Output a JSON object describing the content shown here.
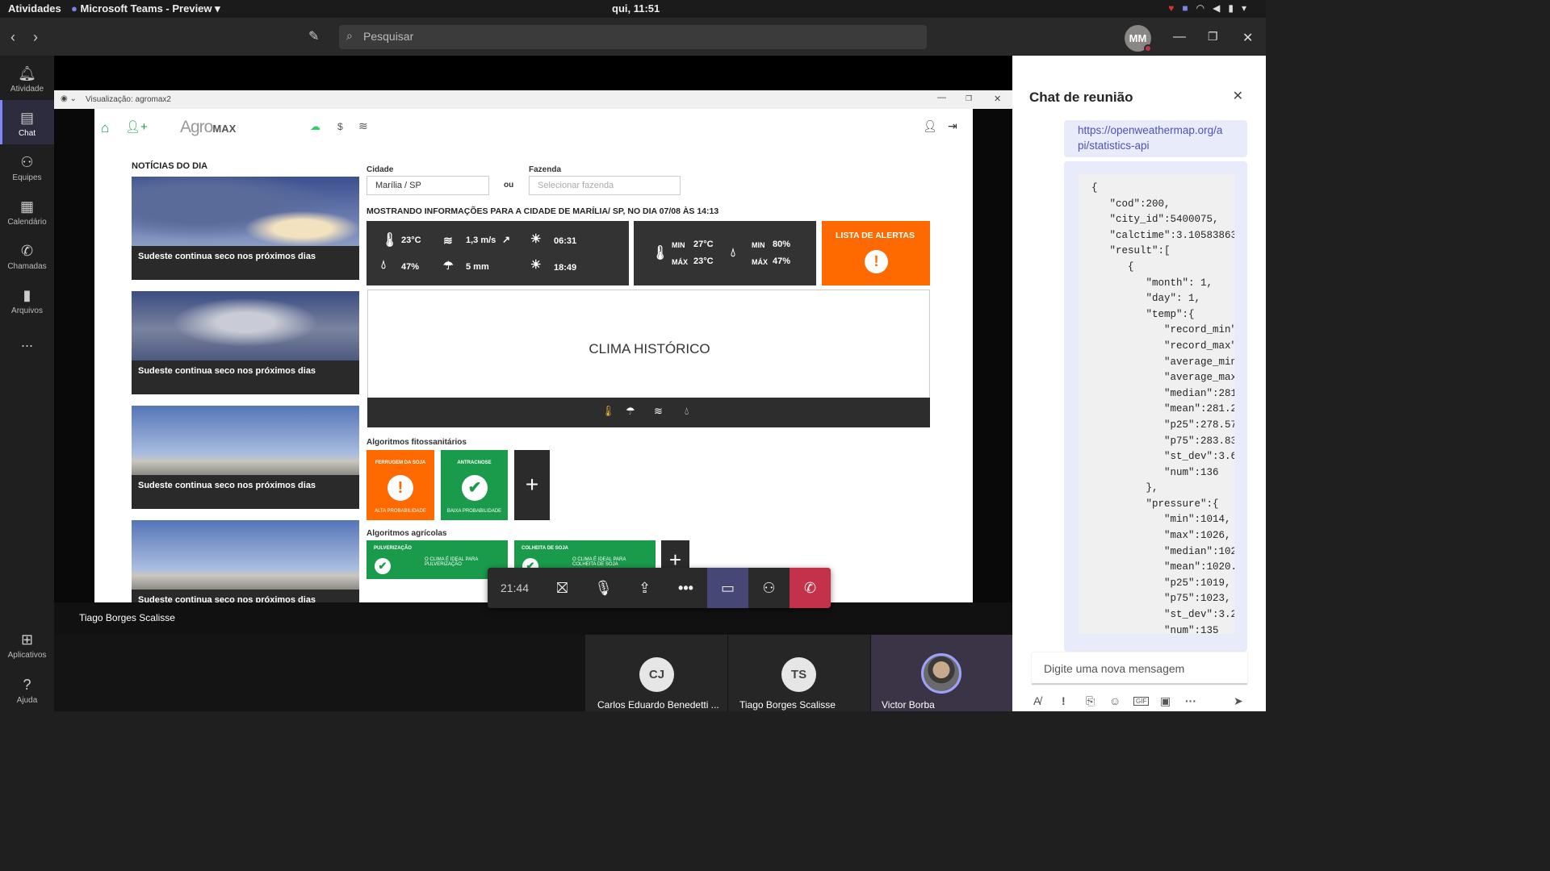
{
  "system_bar": {
    "activities": "Atividades",
    "app_name": "Microsoft Teams - Preview",
    "clock": "qui, 11:51"
  },
  "teams": {
    "search_placeholder": "Pesquisar",
    "avatar_initials": "MM",
    "rail": [
      {
        "label": "Atividade",
        "icon": "bell-icon"
      },
      {
        "label": "Chat",
        "icon": "chat-icon",
        "active": true
      },
      {
        "label": "Equipes",
        "icon": "teams-icon"
      },
      {
        "label": "Calendário",
        "icon": "calendar-icon"
      },
      {
        "label": "Chamadas",
        "icon": "phone-icon"
      },
      {
        "label": "Arquivos",
        "icon": "file-icon"
      },
      {
        "label": "...",
        "icon": "more-icon"
      }
    ],
    "rail_bottom": [
      {
        "label": "Aplicativos",
        "icon": "apps-icon"
      },
      {
        "label": "Ajuda",
        "icon": "help-icon"
      }
    ]
  },
  "share": {
    "window_title": "Visualização: agromax2",
    "presenter": "Tiago Borges Scalisse"
  },
  "app": {
    "logo_agro": "Agro",
    "logo_max": "MAX",
    "news_title": "NOTÍCIAS DO DIA",
    "news": [
      {
        "caption": "Sudeste continua seco nos próximos dias"
      },
      {
        "caption": "Sudeste continua seco nos próximos dias"
      },
      {
        "caption": "Sudeste continua seco nos próximos dias"
      },
      {
        "caption": "Sudeste continua seco nos próximos dias"
      }
    ],
    "city_label": "Cidade",
    "city_value": "Marília / SP",
    "or_label": "ou",
    "farm_label": "Fazenda",
    "farm_placeholder": "Selecionar fazenda",
    "info_heading": "MOSTRANDO INFORMAÇÕES PARA A CIDADE DE MARÍLIA/ SP, NO DIA 07/08 ÀS 14:13",
    "current": {
      "temp": "23°C",
      "wind": "1,3 m/s",
      "sunrise": "06:31",
      "humidity": "47%",
      "rain": "5 mm",
      "sunset": "18:49"
    },
    "minmax": {
      "min_label": "MIN",
      "max_label": "MÁX",
      "temp_min": "27°C",
      "temp_max": "23°C",
      "hum_min": "80%",
      "hum_max": "47%"
    },
    "alerts_label": "LISTA DE ALERTAS",
    "history_title": "CLIMA HISTÓRICO",
    "phyto_title": "Algoritmos fitossanitários",
    "phyto": [
      {
        "name": "FERRUGEM DA SOJA",
        "status": "ALTA PROBABILIDADE",
        "color": "#ff6a00"
      },
      {
        "name": "ANTRACNOSE",
        "status": "BAIXA PROBABILIDADE",
        "color": "#1a9b4b"
      }
    ],
    "agri_title": "Algoritmos agrícolas",
    "agri": [
      {
        "name": "PULVERIZAÇÃO",
        "status": "O CLIMA É IDEAL PARA PULVERIZAÇÃO"
      },
      {
        "name": "COLHEITA DE SOJA",
        "status": "O CLIMA É IDEAL PARA COLHEITA DE SOJA"
      }
    ]
  },
  "call": {
    "timer": "21:44"
  },
  "participants": [
    {
      "initials": "CJ",
      "name": "Carlos Eduardo Benedetti ..."
    },
    {
      "initials": "TS",
      "name": "Tiago Borges Scalisse"
    },
    {
      "initials": "",
      "name": "Victor Borba"
    }
  ],
  "chat": {
    "title": "Chat de reunião",
    "link": "https://openweathermap.org/api/statistics-api",
    "link_line1": "https://openweathermap.org/a",
    "link_line2": "pi/statistics-api",
    "json_text": "{\n   \"cod\":200,\n   \"city_id\":5400075,\n   \"calctime\":3.10583863\n   \"result\":[\n      {\n         \"month\": 1,\n         \"day\": 1,\n         \"temp\":{\n            \"record_min\"\n            \"record_max\"\n            \"average_min\n            \"average_max\n            \"median\":281\n            \"mean\":281.2\n            \"p25\":278.57\n            \"p75\":283.83\n            \"st_dev\":3.6\n            \"num\":136\n         },\n         \"pressure\":{\n            \"min\":1014,\n            \"max\":1026,\n            \"median\":102\n            \"mean\":1020.\n            \"p25\":1019,\n            \"p75\":1023,\n            \"st_dev\":3.2\n            \"num\":135\n         },",
    "compose_placeholder": "Digite uma nova mensagem"
  }
}
